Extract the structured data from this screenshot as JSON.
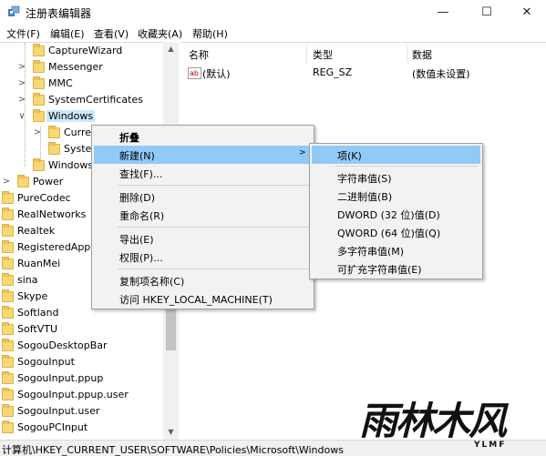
{
  "window": {
    "title": "注册表编辑器",
    "minimize_glyph": "—",
    "maximize_glyph": "☐",
    "close_glyph": "✕"
  },
  "menubar": [
    {
      "label": "文件(F)"
    },
    {
      "label": "编辑(E)"
    },
    {
      "label": "查看(V)"
    },
    {
      "label": "收藏夹(A)"
    },
    {
      "label": "帮助(H)"
    }
  ],
  "tree": {
    "items": [
      {
        "label": "CaptureWizard"
      },
      {
        "label": "Messenger"
      },
      {
        "label": "MMC"
      },
      {
        "label": "SystemCertificates"
      },
      {
        "label": "Windows"
      },
      {
        "label": "Curre"
      },
      {
        "label": "Syster"
      },
      {
        "label": "Windows"
      },
      {
        "label": "Power"
      },
      {
        "label": "PureCodec"
      },
      {
        "label": "RealNetworks"
      },
      {
        "label": "Realtek"
      },
      {
        "label": "RegisteredAppl"
      },
      {
        "label": "RuanMei"
      },
      {
        "label": "sina"
      },
      {
        "label": "Skype"
      },
      {
        "label": "Softland"
      },
      {
        "label": "SoftVTU"
      },
      {
        "label": "SogouDesktopBar"
      },
      {
        "label": "SogouInput"
      },
      {
        "label": "SogouInput.ppup"
      },
      {
        "label": "SogouInput.ppup.user"
      },
      {
        "label": "SogouInput.user"
      },
      {
        "label": "SogouPCInput"
      }
    ],
    "expanded_glyph": "∨",
    "collapsed_glyph": ">"
  },
  "columns": {
    "name": "名称",
    "type": "类型",
    "data": "数据"
  },
  "values": [
    {
      "icon": "ab",
      "name": "(默认)",
      "type": "REG_SZ",
      "data": "(数值未设置)"
    }
  ],
  "context_menu": {
    "items": [
      {
        "label": "折叠",
        "bold": true
      },
      {
        "label": "新建(N)",
        "submenu_arrow": ">",
        "highlighted": true
      },
      {
        "label": "查找(F)..."
      },
      {
        "label": "删除(D)"
      },
      {
        "label": "重命名(R)"
      },
      {
        "label": "导出(E)"
      },
      {
        "label": "权限(P)..."
      },
      {
        "label": "复制项名称(C)"
      },
      {
        "label": "访问 HKEY_LOCAL_MACHINE(T)"
      }
    ]
  },
  "submenu": {
    "items": [
      {
        "label": "项(K)",
        "highlighted": true
      },
      {
        "label": "字符串值(S)"
      },
      {
        "label": "二进制值(B)"
      },
      {
        "label": "DWORD (32 位)值(D)"
      },
      {
        "label": "QWORD (64 位)值(Q)"
      },
      {
        "label": "多字符串值(M)"
      },
      {
        "label": "可扩充字符串值(E)"
      }
    ]
  },
  "statusbar": {
    "path": "计算机\\HKEY_CURRENT_USER\\SOFTWARE\\Policies\\Microsoft\\Windows"
  },
  "watermark": {
    "main": "雨林木风",
    "sub": "YLMF"
  },
  "colors": {
    "highlight": "#91c9f7",
    "selection": "#cce8ff",
    "menu_background": "#f2f2f2",
    "folder": "#f8d775",
    "title_close_hover": "#e81123"
  }
}
